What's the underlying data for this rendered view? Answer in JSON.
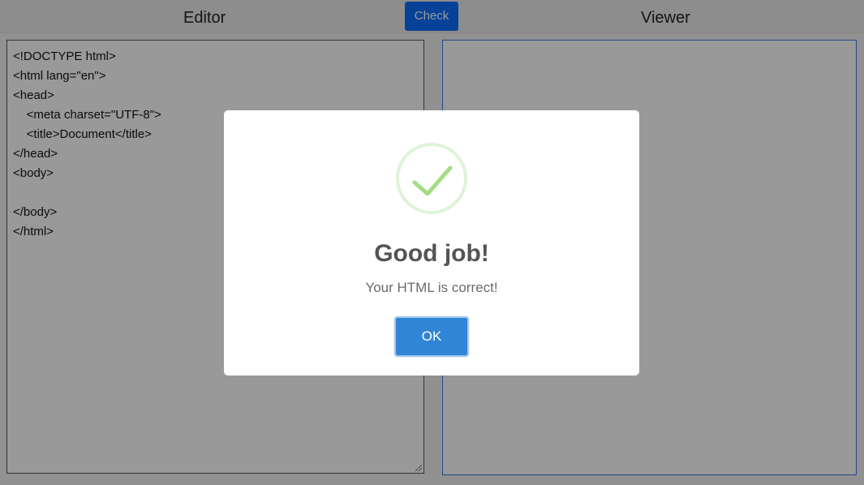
{
  "header": {
    "editor_title": "Editor",
    "viewer_title": "Viewer",
    "check_label": "Check"
  },
  "editor": {
    "lines": [
      "<!DOCTYPE html>",
      "<html lang=\"en\">",
      "<head>",
      "    <meta charset=\"UTF-8\">",
      "    <title>Document</title>",
      "</head>",
      "<body>",
      "",
      "</body>",
      "</html>"
    ]
  },
  "modal": {
    "icon": "success-check-icon",
    "title": "Good job!",
    "text": "Your HTML is correct!",
    "ok_label": "OK"
  },
  "colors": {
    "accent": "#0d6efd",
    "ok_button": "#3085d6",
    "success_ring": "#dff3d8",
    "success_check": "#a5dc86",
    "viewer_border": "#3b7ddd"
  }
}
